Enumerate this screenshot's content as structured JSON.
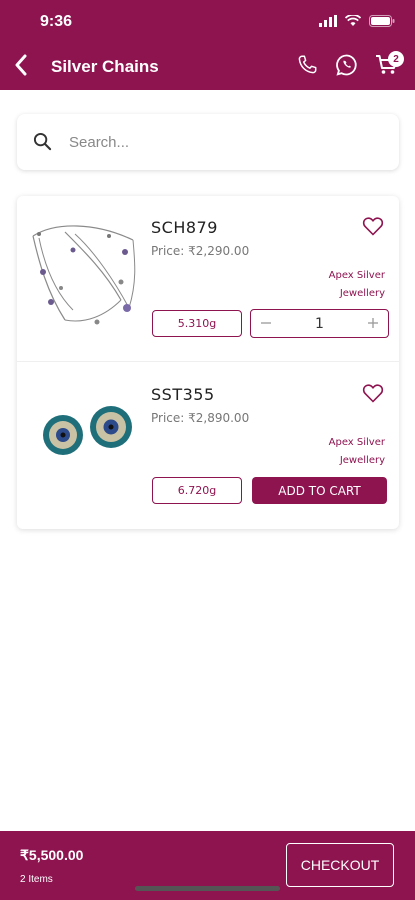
{
  "status_bar": {
    "time": "9:36"
  },
  "header": {
    "title": "Silver Chains",
    "cart_count": "2"
  },
  "search": {
    "placeholder": "Search..."
  },
  "products": [
    {
      "code": "SCH879",
      "price": "Price: ₹2,290.00",
      "brand_line1": "Apex Silver",
      "brand_line2": "Jewellery",
      "weight": "5.310g",
      "in_cart": true,
      "quantity": "1",
      "image": "silver-chain-with-charms"
    },
    {
      "code": "SST355",
      "price": "Price: ₹2,890.00",
      "brand_line1": "Apex Silver",
      "brand_line2": "Jewellery",
      "weight": "6.720g",
      "in_cart": false,
      "add_to_cart_label": "ADD TO CART",
      "image": "evil-eye-stud-earrings"
    }
  ],
  "footer": {
    "total": "₹5,500.00",
    "items": "2 Items",
    "checkout_label": "CHECKOUT"
  },
  "colors": {
    "brand": "#8e1450",
    "background": "#ffffff"
  }
}
